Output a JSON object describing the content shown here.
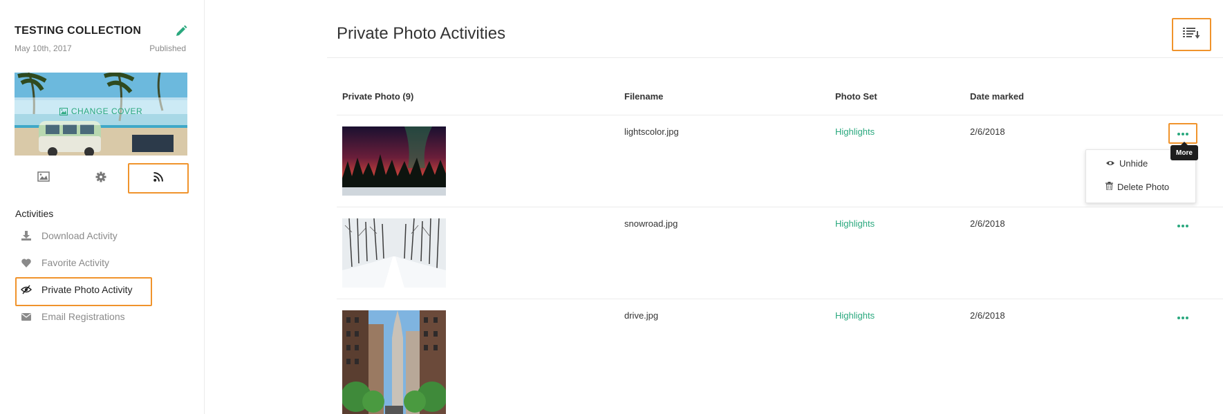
{
  "sidebar": {
    "collection_title": "TESTING COLLECTION",
    "edit_icon": "pencil-icon",
    "date": "May 10th, 2017",
    "status": "Published",
    "change_cover_label": "CHANGE COVER",
    "tabs": [
      {
        "name": "photos",
        "icon": "image-icon"
      },
      {
        "name": "settings",
        "icon": "gear-icon"
      },
      {
        "name": "activities",
        "icon": "rss-icon"
      }
    ],
    "activities_heading": "Activities",
    "activities": [
      {
        "label": "Download Activity",
        "icon": "download-icon"
      },
      {
        "label": "Favorite Activity",
        "icon": "heart-icon"
      },
      {
        "label": "Private Photo Activity",
        "icon": "eye-slash-icon"
      },
      {
        "label": "Email Registrations",
        "icon": "envelope-icon"
      }
    ]
  },
  "main": {
    "title": "Private Photo Activities",
    "sort_icon": "list-sort-icon",
    "columns": [
      "Private Photo (9)",
      "Filename",
      "Photo Set",
      "Date marked"
    ],
    "rows": [
      {
        "filename": "lightscolor.jpg",
        "photo_set": "Highlights",
        "date": "2/6/2018",
        "thumb": "aurora-forest"
      },
      {
        "filename": "snowroad.jpg",
        "photo_set": "Highlights",
        "date": "2/6/2018",
        "thumb": "snowy-road"
      },
      {
        "filename": "drive.jpg",
        "photo_set": "Highlights",
        "date": "2/6/2018",
        "thumb": "city-street"
      }
    ],
    "more_tooltip": "More",
    "more_menu": [
      {
        "label": "Unhide",
        "icon": "eye-icon"
      },
      {
        "label": "Delete Photo",
        "icon": "trash-icon"
      }
    ]
  },
  "colors": {
    "accent": "#2aa87e",
    "highlight": "#f0932b",
    "muted": "#8a8a8a"
  }
}
